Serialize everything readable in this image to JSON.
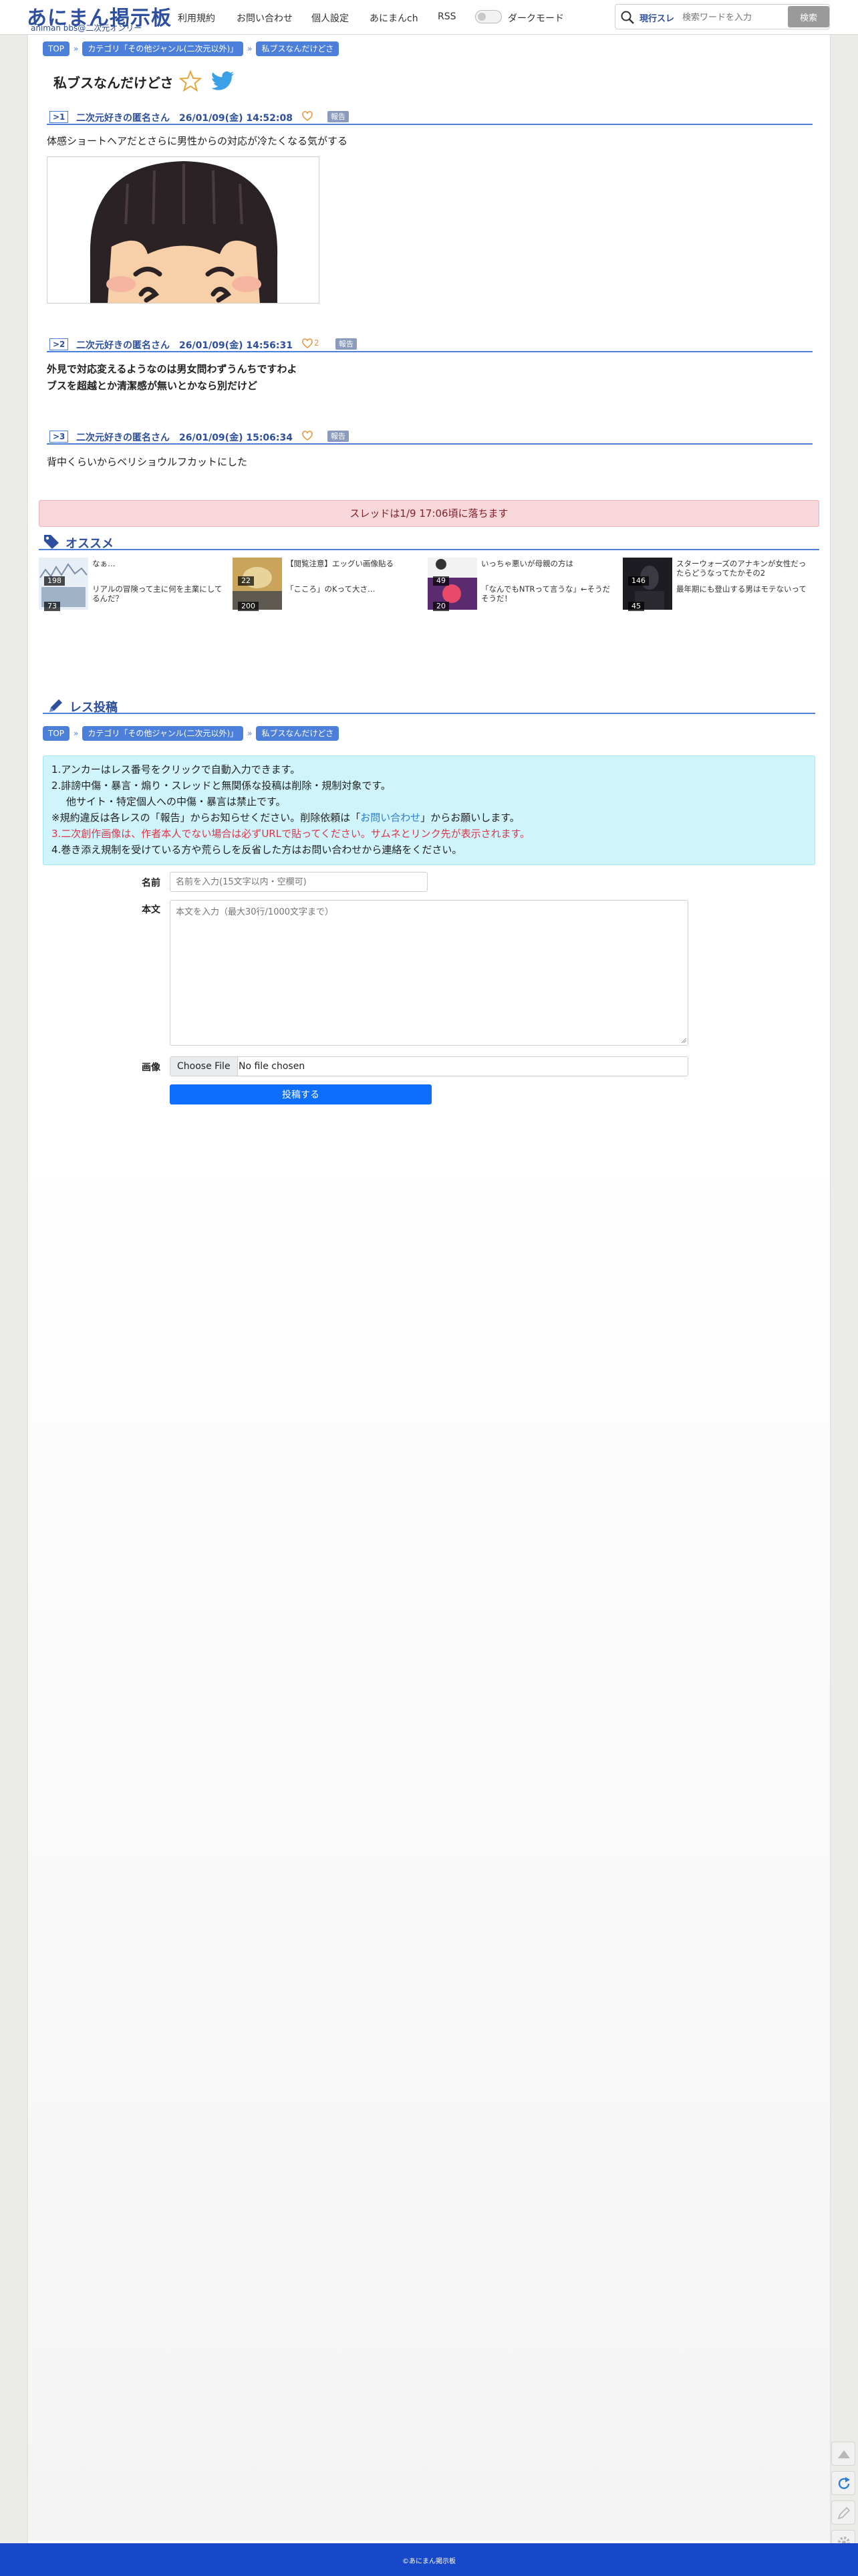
{
  "header": {
    "logo": "あにまん掲示板",
    "logo_sub": "animan bbs@二次元オンリー",
    "nav": [
      "利用規約",
      "お問い合わせ",
      "個人設定",
      "あにまんch",
      "RSS"
    ],
    "dark_mode_label": "ダークモード",
    "search_scope": "現行スレ",
    "search_placeholder": "検索ワードを入力",
    "search_button": "検索"
  },
  "breadcrumbs": [
    "TOP",
    "カテゴリ「その他ジャンル(二次元以外)」",
    "私ブスなんだけどさ"
  ],
  "thread": {
    "title": "私ブスなんだけどさ",
    "posts": [
      {
        "no": ">1",
        "meta": "二次元好きの匿名さん　26/01/09(金) 14:52:08",
        "likes": "",
        "report": "報告",
        "body": [
          "体感ショートヘアだとさらに男性からの対応が冷たくなる気がする"
        ]
      },
      {
        "no": ">2",
        "meta": "二次元好きの匿名さん　26/01/09(金) 14:56:31",
        "likes": "2",
        "report": "報告",
        "body": [
          "外見で対応変えるようなのは男女問わずうんちですわよ",
          "ブスを超越とか清潔感が無いとかなら別だけど"
        ]
      },
      {
        "no": ">3",
        "meta": "二次元好きの匿名さん　26/01/09(金) 15:06:34",
        "likes": "",
        "report": "報告",
        "body": [
          "背中くらいからベリショウルフカットにした"
        ]
      }
    ]
  },
  "expiry_notice": "スレッドは1/9 17:06頃に落ちます",
  "recommend": {
    "heading": "オススメ",
    "items": [
      {
        "title1": "なぁ…",
        "title2": "リアルの冒険って主に何を主業にしてるんだ？",
        "count_top": "198",
        "count_bottom": "73"
      },
      {
        "title1": "【閲覧注意】エッグい画像貼る",
        "title2": "「こころ」のKって大さ…",
        "count_top": "22",
        "count_bottom": "200"
      },
      {
        "title1": "いっちゃ悪いが母親の方は",
        "title2": "「なんでもNTRって言うな」←そうだそうだ！",
        "count_top": "49",
        "count_bottom": "20"
      },
      {
        "title1": "スターウォーズのアナキンが女性だったらどうなってたかその2",
        "title2": "最年期にも登山する男はモテないって",
        "count_top": "146",
        "count_bottom": "45"
      }
    ]
  },
  "form": {
    "heading": "レス投稿",
    "notice": {
      "l1": "1.アンカーはレス番号をクリックで自動入力できます。",
      "l2": "2.誹謗中傷・暴言・煽り・スレッドと無関係な投稿は削除・規制対象です。",
      "l3": "他サイト・特定個人への中傷・暴言は禁止です。",
      "l4a": "※規約違反は各レスの「報告」からお知らせください。削除依頼は「",
      "l4b": "お問い合わせ",
      "l4c": "」からお願いします。",
      "l5": "3.二次創作画像は、作者本人でない場合は必ずURLで貼ってください。サムネとリンク先が表示されます。",
      "l6": "4.巻き添え規制を受けている方や荒らしを反省した方はお問い合わせから連絡をください。"
    },
    "name_label": "名前",
    "name_placeholder": "名前を入力(15文字以内・空欄可)",
    "body_label": "本文",
    "body_placeholder": "本文を入力（最大30行/1000文字まで）",
    "image_label": "画像",
    "file_button": "Choose File",
    "file_status": "No file chosen",
    "submit": "投稿する"
  },
  "footer": "©あにまん掲示板",
  "colors": {
    "accent": "#4b7fd9",
    "brand": "#2d4f9e",
    "footer": "#1748c9",
    "submit": "#0d6efd"
  }
}
